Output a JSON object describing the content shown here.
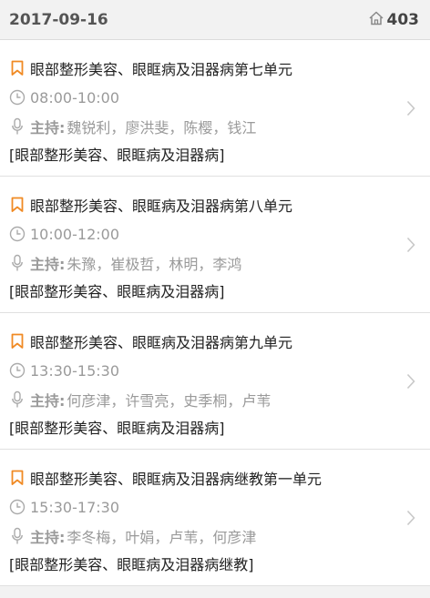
{
  "header": {
    "date": "2017-09-16",
    "room": "403",
    "room_icon": "home-icon"
  },
  "labels": {
    "host": "主持:"
  },
  "colors": {
    "accent": "#f08a24",
    "muted_text": "#9a9a9a",
    "primary_text": "#222222",
    "background": "#f2f2f2"
  },
  "sessions": [
    {
      "title": "眼部整形美容、眼眶病及泪器病第七单元",
      "time": "08:00-10:00",
      "hosts": "魏锐利，廖洪斐，陈樱，钱江",
      "category": "[眼部整形美容、眼眶病及泪器病]"
    },
    {
      "title": "眼部整形美容、眼眶病及泪器病第八单元",
      "time": "10:00-12:00",
      "hosts": "朱豫，崔极哲，林明，李鸿",
      "category": "[眼部整形美容、眼眶病及泪器病]"
    },
    {
      "title": "眼部整形美容、眼眶病及泪器病第九单元",
      "time": "13:30-15:30",
      "hosts": "何彦津，许雪亮，史季桐，卢苇",
      "category": "[眼部整形美容、眼眶病及泪器病]"
    },
    {
      "title": "眼部整形美容、眼眶病及泪器病继教第一单元",
      "time": "15:30-17:30",
      "hosts": "李冬梅，叶娟，卢苇，何彦津",
      "category": "[眼部整形美容、眼眶病及泪器病继教]"
    }
  ]
}
